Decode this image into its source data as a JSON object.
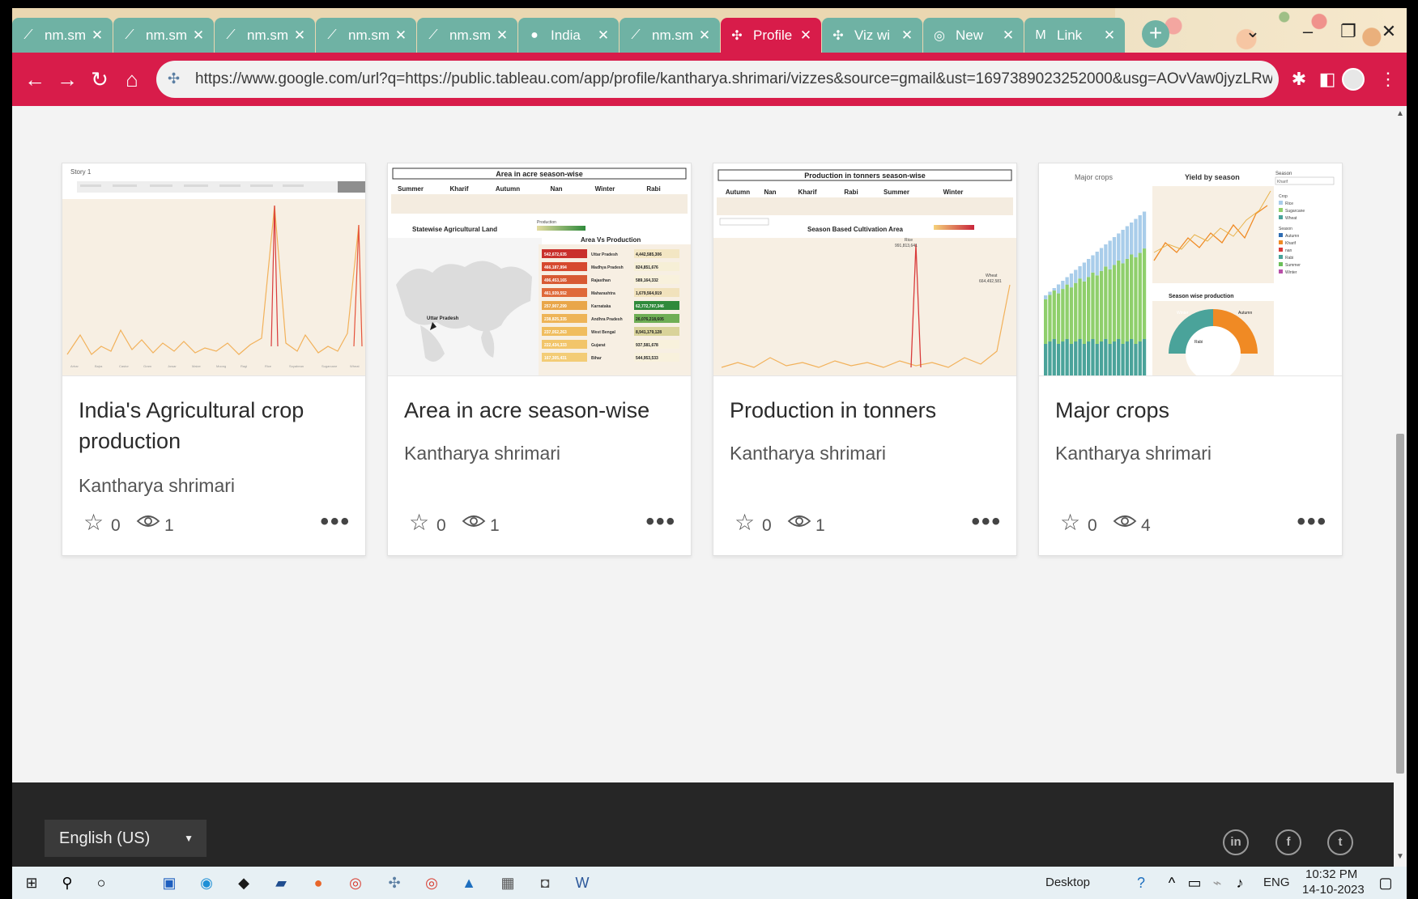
{
  "browser": {
    "tabs": [
      {
        "label": "nm.sm",
        "icon": "tableau-file-icon",
        "active": false
      },
      {
        "label": "nm.sm",
        "icon": "tableau-file-icon",
        "active": false
      },
      {
        "label": "nm.sm",
        "icon": "tableau-file-icon",
        "active": false
      },
      {
        "label": "nm.sm",
        "icon": "tableau-file-icon",
        "active": false
      },
      {
        "label": "nm.sm",
        "icon": "tableau-file-icon",
        "active": false
      },
      {
        "label": "India",
        "icon": "github-icon",
        "active": false
      },
      {
        "label": "nm.sm",
        "icon": "tableau-file-icon",
        "active": false
      },
      {
        "label": "Profile",
        "icon": "tableau-icon",
        "active": true
      },
      {
        "label": "Viz wi",
        "icon": "tableau-icon",
        "active": false
      },
      {
        "label": "New",
        "icon": "chrome-icon",
        "active": false
      },
      {
        "label": "Link",
        "icon": "gmail-icon",
        "active": false
      }
    ],
    "new_tab": "+",
    "url": "https://www.google.com/url?q=https://public.tableau.com/app/profile/kantharya.shrimari/vizzes&source=gmail&ust=1697389023252000&usg=AOvVaw0jyzLRwdCl4..."
  },
  "cards": [
    {
      "title": "India's Agricultural crop production",
      "author": "Kantharya shrimari",
      "favorites": "0",
      "views": "1",
      "thumb": {
        "header": "Story 1",
        "type": "line-story"
      }
    },
    {
      "title": "Area in acre season-wise",
      "author": "Kantharya shrimari",
      "favorites": "0",
      "views": "1",
      "thumb": {
        "header": "Area in acre season-wise",
        "seasons": [
          "Summer",
          "Kharif",
          "Autumn",
          "Nan",
          "Winter",
          "Rabi"
        ],
        "map_title": "Statewise Agricultural Land",
        "legend_title": "Production",
        "map_label": "Uttar Pradesh",
        "bars_title": "Area Vs Production",
        "rows": [
          {
            "left": "542,672,635",
            "state": "Uttar Pradesh",
            "right": "4,442,585,306"
          },
          {
            "left": "466,187,994",
            "state": "Madhya Pradesh",
            "right": "824,851,676"
          },
          {
            "left": "496,453,165",
            "state": "Rajasthan",
            "right": "589,164,332"
          },
          {
            "left": "461,939,552",
            "state": "Maharashtra",
            "right": "1,679,564,919"
          },
          {
            "left": "257,907,299",
            "state": "Karnataka",
            "right": "62,772,797,346"
          },
          {
            "left": "238,825,335",
            "state": "Andhra Pradesh",
            "right": "26,076,218,605"
          },
          {
            "left": "237,052,263",
            "state": "West Bengal",
            "right": "8,941,179,128"
          },
          {
            "left": "222,434,333",
            "state": "Gujarat",
            "right": "937,581,678"
          },
          {
            "left": "167,305,431",
            "state": "Bihar",
            "right": "544,953,533"
          }
        ]
      }
    },
    {
      "title": "Production in tonners",
      "author": "Kantharya shrimari",
      "favorites": "0",
      "views": "1",
      "thumb": {
        "header": "Production in tonners season-wise",
        "seasons": [
          "Autumn",
          "Nan",
          "Kharif",
          "Rabi",
          "Summer",
          "Winter"
        ],
        "sub_title": "Season Based Cultivation Area",
        "peak_label": "Rice",
        "peak_value": "991,813,641",
        "right_label": "Wheat",
        "right_value": "664,492,581"
      }
    },
    {
      "title": "Major crops",
      "author": "Kantharya shrimari",
      "favorites": "0",
      "views": "4",
      "thumb": {
        "left_title": "Major crops",
        "mid_title": "Yield by season",
        "filter_label": "Season",
        "filter_value": "Kharif",
        "pie_title": "Season wise production",
        "pie_labels": [
          "Winter",
          "Autumn",
          "Rabi"
        ],
        "legend_heading_1": "Crop",
        "legend_crop": [
          "Rice",
          "Sugarcane",
          "Wheat"
        ],
        "legend_heading_2": "Season",
        "legend_season": [
          "Autumn",
          "Kharif",
          "nan",
          "Rabi",
          "Summer",
          "Winter"
        ]
      }
    }
  ],
  "footer": {
    "language": "English (US)",
    "social": [
      "linkedin-icon",
      "facebook-icon",
      "twitter-icon"
    ]
  },
  "taskbar": {
    "desktop_label": "Desktop",
    "language": "ENG",
    "time": "10:32 PM",
    "date": "14-10-2023"
  },
  "colors": {
    "accent": "#d81c4a",
    "tab": "#6fb2a4",
    "footer": "#262626"
  }
}
